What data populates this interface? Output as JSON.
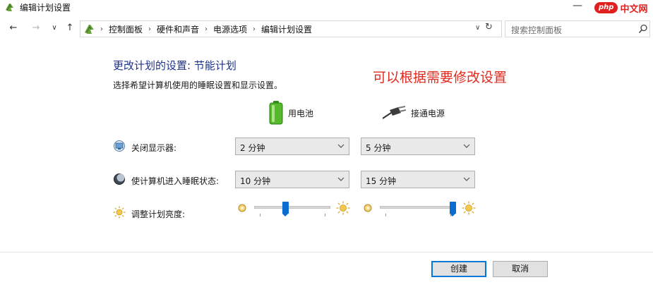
{
  "window": {
    "title": "编辑计划设置",
    "watermark_badge": "php",
    "watermark_text": "中文网"
  },
  "address_bar": {
    "breadcrumbs": [
      "控制面板",
      "硬件和声音",
      "电源选项",
      "编辑计划设置"
    ],
    "search_placeholder": "搜索控制面板"
  },
  "page": {
    "heading": "更改计划的设置: 节能计划",
    "subheading": "选择希望计算机使用的睡眠设置和显示设置。",
    "annotation": "可以根据需要修改设置"
  },
  "columns": {
    "battery_label": "用电池",
    "plugged_label": "接通电源"
  },
  "settings": {
    "display_off": {
      "label": "关闭显示器:",
      "battery_value": "2 分钟",
      "plugged_value": "5 分钟"
    },
    "sleep": {
      "label": "使计算机进入睡眠状态:",
      "battery_value": "10 分钟",
      "plugged_value": "15 分钟"
    },
    "brightness": {
      "label": "调整计划亮度:",
      "battery_level": 0.4,
      "plugged_level": 1.0
    }
  },
  "buttons": {
    "create": "创建",
    "cancel": "取消"
  },
  "colors": {
    "heading": "#1e3287",
    "annotation": "#e02a1f",
    "slider_thumb": "#0a6bd0",
    "watermark": "#e0201f"
  }
}
